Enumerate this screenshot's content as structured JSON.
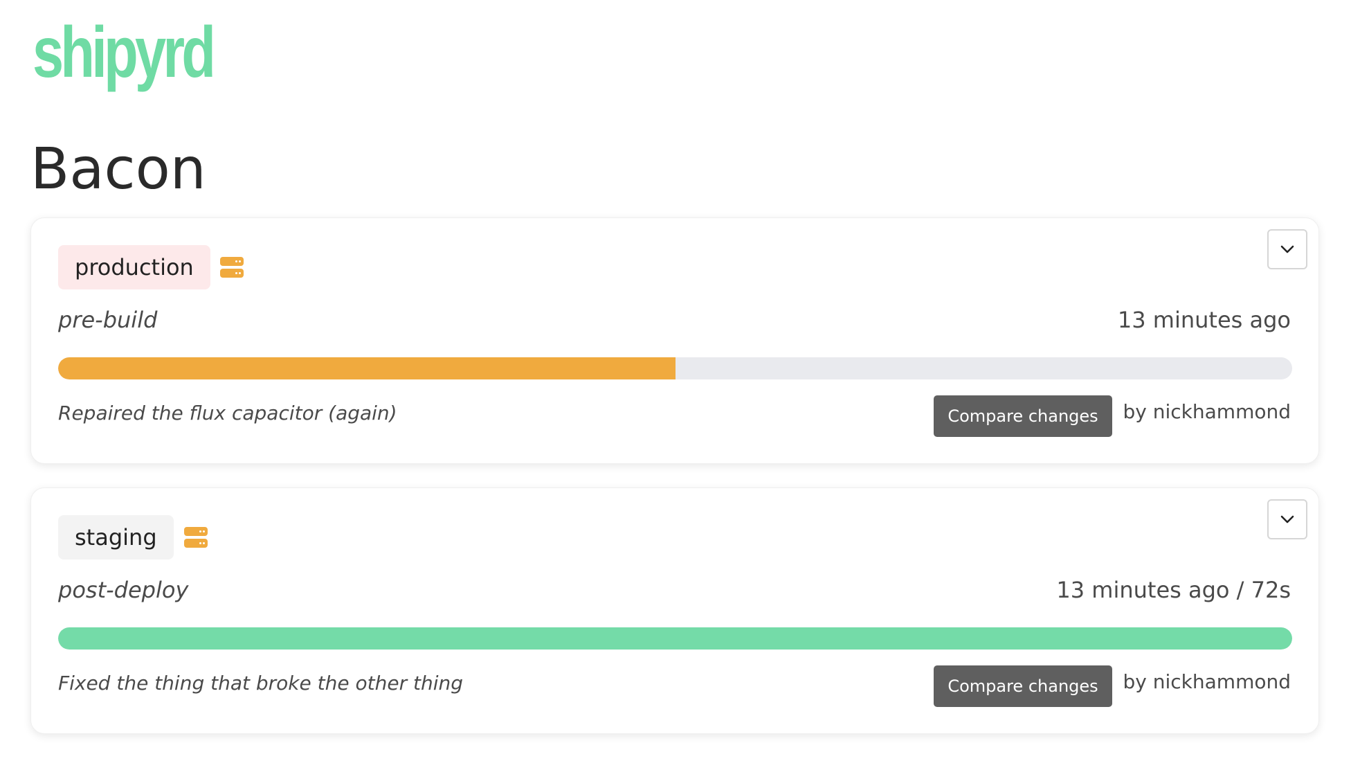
{
  "app": {
    "logo_text": "shipyrd",
    "logo_color": "#6fdba4"
  },
  "project": {
    "title": "Bacon"
  },
  "deploys": [
    {
      "environment": "production",
      "environment_color": "#fde9ea",
      "icon": "server-icon",
      "stage": "pre-build",
      "time": "13 minutes ago",
      "progress_fraction": 0.5,
      "progress_color": "#f0aa3e",
      "commit_message": "Repaired the flux capacitor (again)",
      "compare_label": "Compare changes",
      "author": "by nickhammond"
    },
    {
      "environment": "staging",
      "environment_color": "#f3f3f3",
      "icon": "server-icon",
      "stage": "post-deploy",
      "time": "13 minutes ago / 72s",
      "progress_fraction": 1.0,
      "progress_color": "#74dba8",
      "commit_message": "Fixed the thing that broke the other thing",
      "compare_label": "Compare changes",
      "author": "by nickhammond"
    }
  ]
}
